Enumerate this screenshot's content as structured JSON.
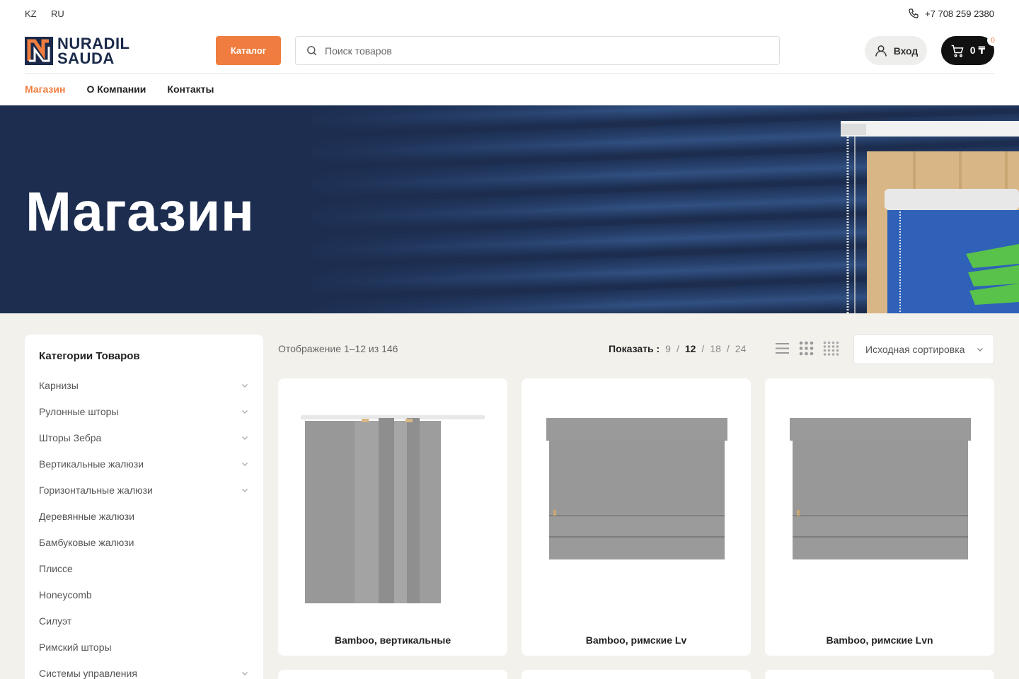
{
  "topbar": {
    "lang_kz": "KZ",
    "lang_ru": "RU",
    "phone": "+7 708 259 2380"
  },
  "header": {
    "logo_line1": "NURADIL",
    "logo_line2": "SAUDA",
    "catalog_label": "Каталог",
    "search_placeholder": "Поиск товаров",
    "login_label": "Вход",
    "cart_total": "0 ₸",
    "cart_count": "0"
  },
  "nav": {
    "items": [
      "Магазин",
      "О Компании",
      "Контакты"
    ],
    "active": "Магазин"
  },
  "banner": {
    "title": "Магазин"
  },
  "sidebar": {
    "title": "Категории Товаров",
    "items": [
      {
        "label": "Карнизы",
        "expandable": true
      },
      {
        "label": "Рулонные шторы",
        "expandable": true
      },
      {
        "label": "Шторы Зебра",
        "expandable": true
      },
      {
        "label": "Вертикальные жалюзи",
        "expandable": true
      },
      {
        "label": "Горизонтальные жалюзи",
        "expandable": true
      },
      {
        "label": "Деревянные жалюзи",
        "expandable": false
      },
      {
        "label": "Бамбуковые жалюзи",
        "expandable": false
      },
      {
        "label": "Плиссе",
        "expandable": false
      },
      {
        "label": "Honeycomb",
        "expandable": false
      },
      {
        "label": "Силуэт",
        "expandable": false
      },
      {
        "label": "Римский шторы",
        "expandable": false
      },
      {
        "label": "Системы управления",
        "expandable": true
      }
    ]
  },
  "toolbar": {
    "result_count": "Отображение 1–12 из 146",
    "show_label": "Показать :",
    "per_page": [
      "9",
      "12",
      "18",
      "24"
    ],
    "per_page_current": "12",
    "sort_label": "Исходная сортировка"
  },
  "products": [
    {
      "title": "Bamboo, вертикальные",
      "icon": "vertical-blinds-image"
    },
    {
      "title": "Bamboo, римские Lv",
      "icon": "roman-blind-image"
    },
    {
      "title": "Bamboo, римские Lvn",
      "icon": "roman-blind-image"
    }
  ],
  "colors": {
    "accent": "#f07d3f",
    "navy": "#1c2d4f",
    "page_bg": "#f3f1ec"
  }
}
